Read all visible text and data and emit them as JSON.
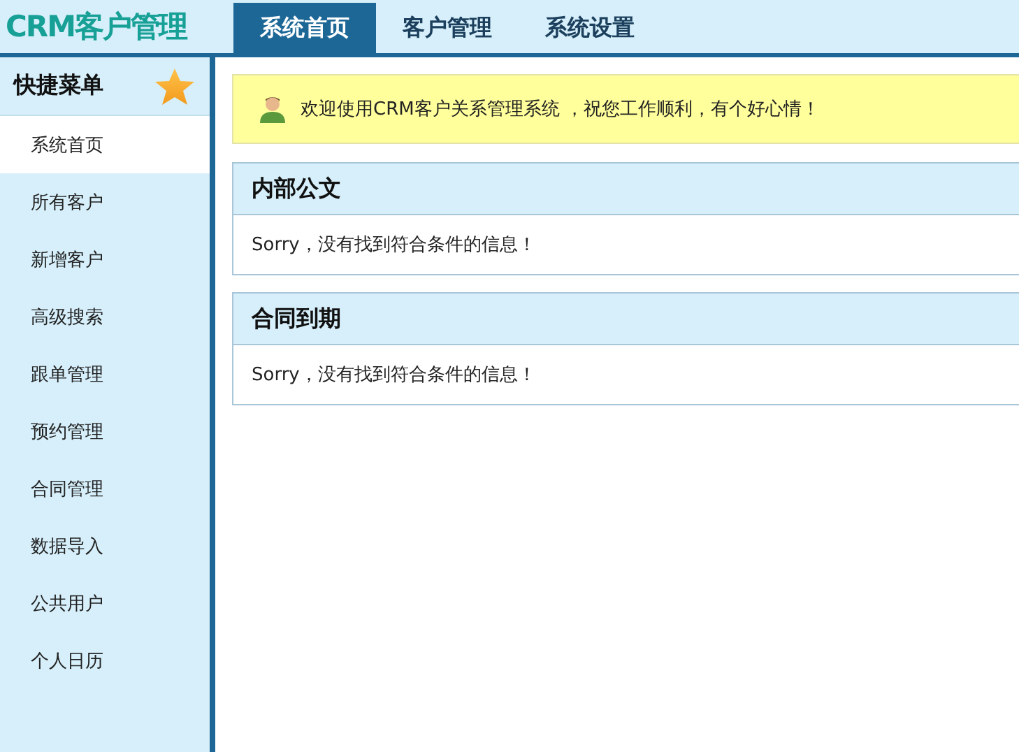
{
  "header": {
    "logo": "CRM客户管理",
    "tabs": [
      {
        "label": "系统首页",
        "selected": true
      },
      {
        "label": "客户管理",
        "selected": false
      },
      {
        "label": "系统设置",
        "selected": false
      }
    ]
  },
  "sidebar": {
    "title": "快捷菜单",
    "items": [
      {
        "label": "系统首页",
        "selected": true
      },
      {
        "label": "所有客户",
        "selected": false
      },
      {
        "label": "新增客户",
        "selected": false
      },
      {
        "label": "高级搜索",
        "selected": false
      },
      {
        "label": "跟单管理",
        "selected": false
      },
      {
        "label": "预约管理",
        "selected": false
      },
      {
        "label": "合同管理",
        "selected": false
      },
      {
        "label": "数据导入",
        "selected": false
      },
      {
        "label": "公共用户",
        "selected": false
      },
      {
        "label": "个人日历",
        "selected": false
      }
    ]
  },
  "welcome": "欢迎使用CRM客户关系管理系统 ，祝您工作顺利，有个好心情！",
  "panels": [
    {
      "title": "内部公文",
      "message": "Sorry，没有找到符合条件的信息！"
    },
    {
      "title": "合同到期",
      "message": "Sorry，没有找到符合条件的信息！"
    }
  ]
}
